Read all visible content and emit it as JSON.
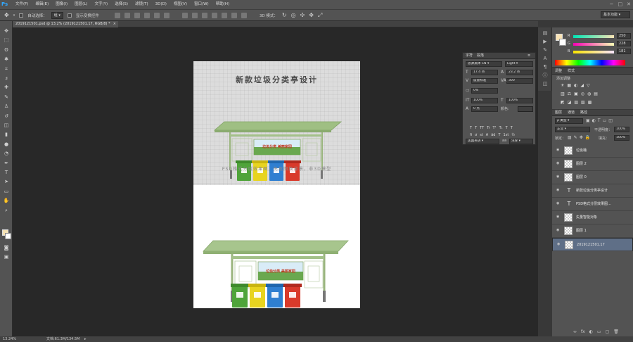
{
  "app": {
    "logo": "Ps"
  },
  "menu": [
    "文件(F)",
    "编辑(E)",
    "图像(I)",
    "图层(L)",
    "文字(Y)",
    "选择(S)",
    "滤镜(T)",
    "3D(D)",
    "视图(V)",
    "窗口(W)",
    "帮助(H)"
  ],
  "window_controls": [
    "−",
    "□",
    "✕"
  ],
  "options_bar": {
    "auto_select_label": "自动选择：",
    "auto_select_value": "组",
    "show_transform_label": "显示变换控件",
    "mode_label": "3D 模式："
  },
  "workspace": "基本功能",
  "document_tab": {
    "title": "2019121501.psd @ 13.2% (2019121501.17, RGB/8) *",
    "close": "×"
  },
  "document": {
    "title": "新款垃圾分类亭设计",
    "subtitle": "PSD格式分层效果图，免抠图换背景，非3D模型",
    "banner_text": "垃圾分类 美丽家园"
  },
  "status": {
    "zoom": "13.24%",
    "doc_size": "文档:61.3M/134.5M",
    "arrow": "▸"
  },
  "color_panel": {
    "tabs": [
      "颜色",
      "色板"
    ],
    "r": {
      "label": "R",
      "value": "250"
    },
    "g": {
      "label": "G",
      "value": "228"
    },
    "b": {
      "label": "B",
      "value": "181"
    }
  },
  "adjustments_panel": {
    "tabs": [
      "调整",
      "样式"
    ],
    "heading": "添加调整",
    "row1": [
      "☀",
      "▦",
      "◐",
      "◢",
      "▽"
    ],
    "row2": [
      "▥",
      "⚖",
      "▣",
      "◎",
      "◍",
      "▤"
    ],
    "row3": [
      "◩",
      "◪",
      "▨",
      "▧",
      "▩"
    ]
  },
  "layers_panel": {
    "tabs": [
      "图层",
      "通道",
      "路径"
    ],
    "filter": "ρ 类型",
    "blend_mode": "正常",
    "opacity_label": "不透明度：",
    "opacity_value": "100%",
    "lock_label": "锁定：",
    "fill_label": "填充：",
    "fill_value": "100%",
    "layers": [
      {
        "name": "垃圾桶",
        "type": "image"
      },
      {
        "name": "图层 2",
        "type": "image"
      },
      {
        "name": "图层 0",
        "type": "image"
      },
      {
        "name": "新款垃圾分类亭设计",
        "type": "text"
      },
      {
        "name": "PSD格式分层效果图...",
        "type": "text"
      },
      {
        "name": "矢量智能对象",
        "type": "smart"
      },
      {
        "name": "图层 1",
        "type": "image"
      },
      {
        "name": "2019121501.17",
        "type": "image",
        "selected": true
      }
    ],
    "bottom_icons": [
      "∞",
      "fx",
      "◐",
      "▭",
      "▢",
      "🗑"
    ]
  },
  "character_panel": {
    "tabs": [
      "字符",
      "段落"
    ],
    "font_family": "思源黑体 CN",
    "font_style": "Light",
    "font_size": "17.4 点",
    "leading": "23.2 点",
    "kerning": "度量标准",
    "tracking": "300",
    "scale_pct": "0%",
    "vscale": "100%",
    "hscale": "100%",
    "baseline": "0 点",
    "color_label": "颜色:",
    "styles_row1": [
      "T",
      "T",
      "TT",
      "Tr",
      "T¹",
      "T₁",
      "T",
      "T"
    ],
    "styles_row2": [
      "fi",
      "ơ",
      "st",
      "A",
      "ād",
      "T",
      "1st",
      "½"
    ],
    "language": "美国英语",
    "aa": "浑厚"
  }
}
